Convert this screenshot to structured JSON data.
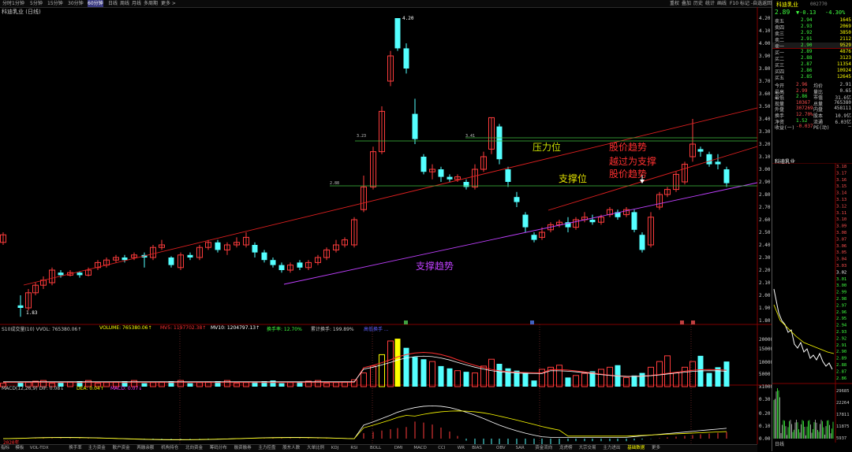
{
  "toolbar": {
    "items": [
      "分时",
      "1分钟",
      "5分钟",
      "15分钟",
      "30分钟",
      "60分钟",
      "日线",
      "周线",
      "月线",
      "多周期",
      "更多 >"
    ],
    "right": [
      "重权",
      "叠加",
      "历史",
      "统计",
      "画线",
      "F10",
      "标记",
      "-自选",
      "返回"
    ]
  },
  "chart_subtitle": "科迪乳业 (日线)",
  "price_axis": [
    "4.20",
    "4.10",
    "4.00",
    "3.90",
    "3.80",
    "3.70",
    "3.60",
    "3.50",
    "3.40",
    "3.30",
    "3.20",
    "3.10",
    "3.00",
    "2.90",
    "2.80",
    "2.70",
    "2.60",
    "2.50",
    "2.40",
    "2.30",
    "2.20",
    "2.10",
    "2.00",
    "1.90",
    "1.80"
  ],
  "markers": {
    "high": "4.20",
    "low": "1.83",
    "h1": "3.41",
    "h2": "3.23",
    "h3": "2.88"
  },
  "annotations": {
    "pressure_level": "压力位",
    "price_trend": "股价趋势",
    "trend_break": "股价趋势",
    "trend_break2": "越过为支撑",
    "support_level": "支撑位",
    "support_trend": "支撑趋势"
  },
  "volume_header": {
    "title": "S10成交量(10) VVOL: 765380.06↑",
    "volume": "VOLUME: 765380.06↑",
    "mv5": "MV5: 1197702.38↑",
    "mv10": "MV10: 1204797.13↑",
    "turnover": "换手率: 12.70%",
    "cum_turnover": "累计换手: 199.89%",
    "extra": "高低换手 ..."
  },
  "volume_axis": [
    "20000",
    "15000",
    "10000",
    "5000",
    "x10000"
  ],
  "macd_header": {
    "title": "MACD(12,26,9) DIF: 0.08↓",
    "dea": "DEA: 0.04↑",
    "macd": "MACD: 0.07↓"
  },
  "macd_axis": [
    "0.30",
    "0.20",
    "0.10",
    "0.00"
  ],
  "bottom_tabs": [
    "指标",
    "模板",
    "VOL-TDX",
    "换手率",
    "主力资金",
    "散户资金",
    "两融余额",
    "机构持仓",
    "北向资金",
    "筹码分布",
    "融资融券",
    "主力控盘",
    "股东人数",
    "大单比例",
    "KDJ",
    "RSI",
    "BOLL",
    "DMI",
    "MACD",
    "CCI",
    "WR",
    "BIAS",
    "OBV",
    "SAR",
    "资金流向",
    "龙虎榜",
    "大宗交易",
    "主力进出",
    "基础数据",
    "更多"
  ],
  "year_label": "2020年",
  "quote": {
    "name": "科迪乳业",
    "code": "002770",
    "price": "2.89",
    "change": "▼-0.13",
    "pct": "-4.30%",
    "asks": [
      {
        "label": "卖五",
        "price": "2.94",
        "vol": "1645"
      },
      {
        "label": "卖四",
        "price": "2.93",
        "vol": "2069"
      },
      {
        "label": "卖三",
        "price": "2.92",
        "vol": "3850"
      },
      {
        "label": "卖二",
        "price": "2.91",
        "vol": "2112"
      },
      {
        "label": "卖一",
        "price": "2.90",
        "vol": "9529"
      }
    ],
    "bids": [
      {
        "label": "买一",
        "price": "2.89",
        "vol": "4876"
      },
      {
        "label": "买二",
        "price": "2.88",
        "vol": "3123"
      },
      {
        "label": "买三",
        "price": "2.87",
        "vol": "11354"
      },
      {
        "label": "买四",
        "price": "2.86",
        "vol": "10924"
      },
      {
        "label": "买五",
        "price": "2.85",
        "vol": "12645"
      }
    ],
    "stats": [
      {
        "a": "今开",
        "b": "2.96",
        "c": "均价",
        "d": "2.91"
      },
      {
        "a": "最高",
        "b": "2.99",
        "c": "量比",
        "d": "0.65"
      },
      {
        "a": "最低",
        "b": "2.86",
        "c": "市值",
        "d": "31.6亿"
      },
      {
        "a": "现量",
        "b": "10367",
        "c": "总量",
        "d": "765380"
      },
      {
        "a": "外盘",
        "b": "307269",
        "c": "内盘",
        "d": "458111"
      },
      {
        "a": "换手",
        "b": "12.70%",
        "c": "股本",
        "d": "10.9亿"
      },
      {
        "a": "净资",
        "b": "1.52",
        "c": "流通",
        "d": "6.03亿"
      },
      {
        "a": "收益(一)",
        "b": "-0.037",
        "c": "PE(动)",
        "d": "—"
      }
    ],
    "mini_title": "科迪乳业",
    "mini_axis": [
      "3.18",
      "3.17",
      "3.16",
      "3.15",
      "3.14",
      "3.13",
      "3.12",
      "3.11",
      "3.10",
      "3.09",
      "3.08",
      "3.07",
      "3.06",
      "3.05",
      "3.04",
      "3.03",
      "3.02",
      "3.01",
      "3.00",
      "2.99",
      "2.98",
      "2.97",
      "2.96",
      "2.95",
      "2.94",
      "2.93",
      "2.92",
      "2.91",
      "2.90",
      "2.89",
      "2.88",
      "2.87",
      "2.86"
    ],
    "mini_vol_axis": [
      "29685",
      "22264",
      "17811",
      "11875",
      "5937"
    ],
    "mini_bottom": "日线"
  },
  "colors": {
    "up": "#ff3c3c",
    "down": "#54ffff",
    "ma5": "#ffffff",
    "ma10": "#ffff00",
    "trend": "#e02020",
    "support": "#c040ff",
    "hline": "#40c040"
  }
}
